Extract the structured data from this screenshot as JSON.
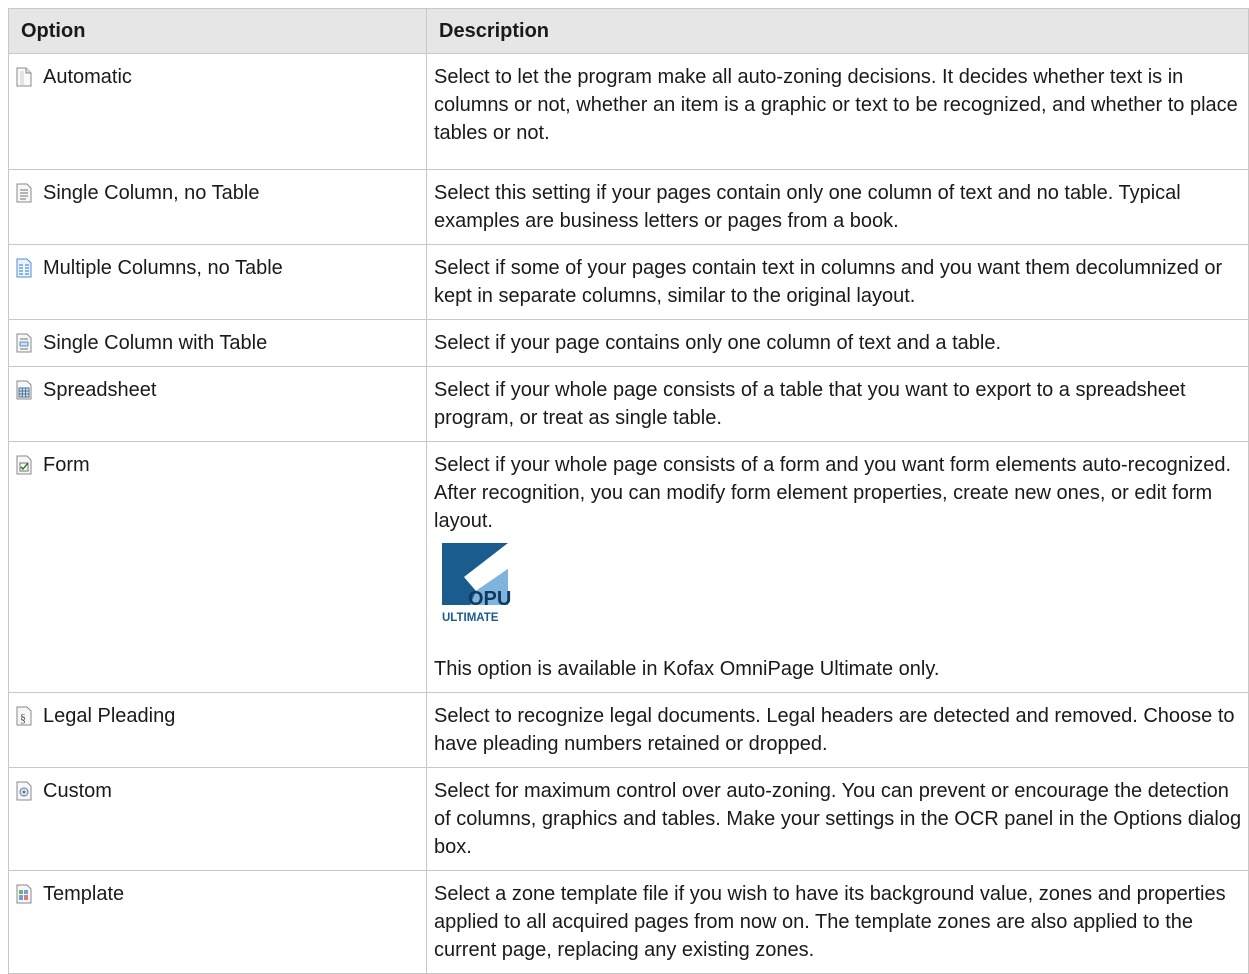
{
  "headers": {
    "option": "Option",
    "description": "Description"
  },
  "rows": [
    {
      "option": "Automatic",
      "icon": "automatic-icon",
      "description": "Select to let the program make all auto-zoning decisions. It decides whether text is in columns or not, whether an item is a graphic or text to be recognized, and whether to place tables or not."
    },
    {
      "option": "Single Column, no Table",
      "icon": "single-column-icon",
      "description": "Select this setting if your pages contain only one column of text and no table. Typical examples are business letters or pages from a book."
    },
    {
      "option": "Multiple Columns, no Table",
      "icon": "multiple-columns-icon",
      "description": "Select if some of your pages contain text in columns and you want them decolumnized or kept in separate columns, similar to the original layout."
    },
    {
      "option": "Single Column with Table",
      "icon": "single-column-table-icon",
      "description": "Select if your page contains only one column of text and a table."
    },
    {
      "option": "Spreadsheet",
      "icon": "spreadsheet-icon",
      "description": "Select if your whole page consists of a table that you want to export to a spreadsheet program, or treat as single table."
    },
    {
      "option": "Form",
      "icon": "form-icon",
      "description": "Select if your whole page consists of a form and you want form elements auto-recognized. After recognition, you can modify form element properties, create new ones, or edit form layout.",
      "logo": {
        "main": "OPU",
        "sub": "ULTIMATE",
        "letter": "K"
      },
      "note": "This option is available in Kofax OmniPage Ultimate only."
    },
    {
      "option": "Legal Pleading",
      "icon": "legal-pleading-icon",
      "description": "Select to recognize legal documents. Legal headers are detected and removed. Choose to have pleading numbers retained or dropped."
    },
    {
      "option": "Custom",
      "icon": "custom-icon",
      "description": "Select for maximum control over auto-zoning. You can prevent or encourage the detection of columns, graphics and tables. Make your settings in the OCR panel in the Options dialog box."
    },
    {
      "option": "Template",
      "icon": "template-icon",
      "description": "Select a zone template file if you wish to have its background value, zones and properties applied to all acquired pages from now on. The template zones are also applied to the current page, replacing any existing zones."
    }
  ],
  "colors": {
    "header_bg": "#e6e6e6",
    "border": "#c8c8c8",
    "logo_blue": "#1b5c8e",
    "logo_light": "#7fb5dd"
  }
}
